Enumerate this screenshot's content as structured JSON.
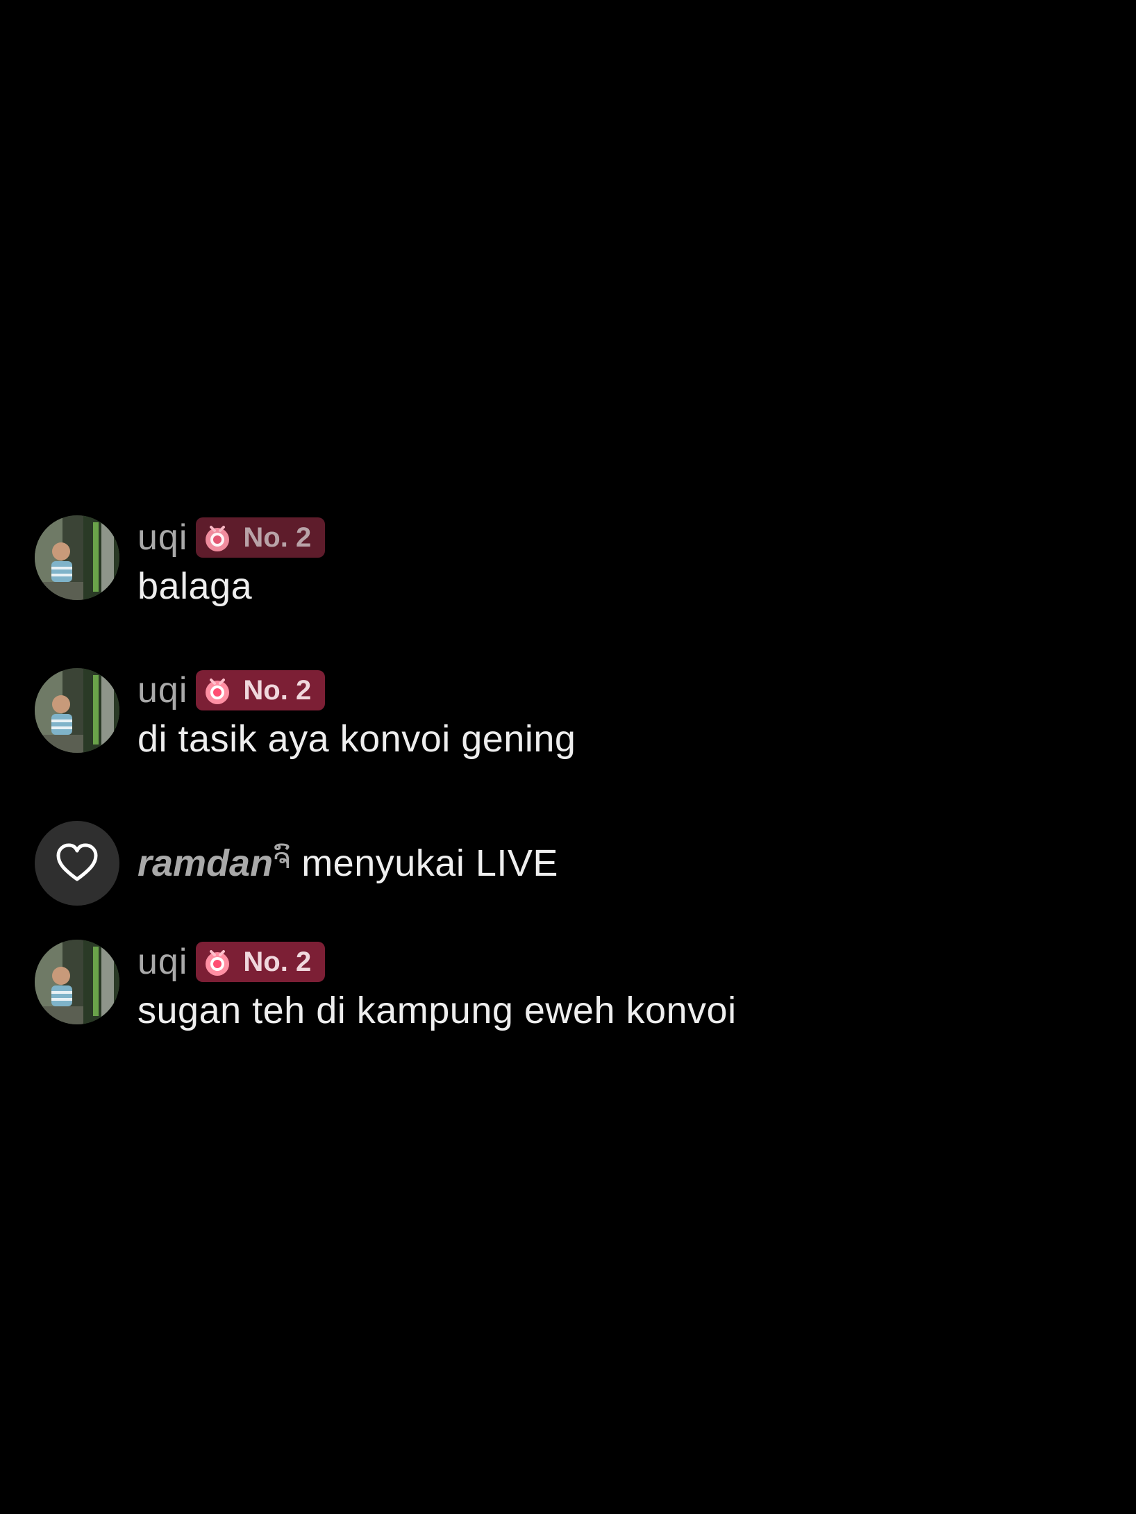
{
  "comments": [
    {
      "username": "uqi",
      "badge": "No. 2",
      "badge_icon": "gift-sticker-icon",
      "message": "balaga"
    },
    {
      "username": "uqi",
      "badge": "No. 2",
      "badge_icon": "gift-sticker-icon",
      "message": "di tasik aya konvoi gening"
    },
    {
      "username": "uqi",
      "badge": "No. 2",
      "badge_icon": "gift-sticker-icon",
      "message": "sugan teh di kampung eweh konvoi"
    }
  ],
  "like_event": {
    "username": "ramdan",
    "name_decoration": "ຈົ",
    "text": "menyukai LIVE",
    "icon": "heart-icon"
  },
  "colors": {
    "background": "#000000",
    "badge": "#7c1f35",
    "username": "#a9a9a9",
    "message": "#eeeeee",
    "like_circle": "#2f2f2f"
  }
}
